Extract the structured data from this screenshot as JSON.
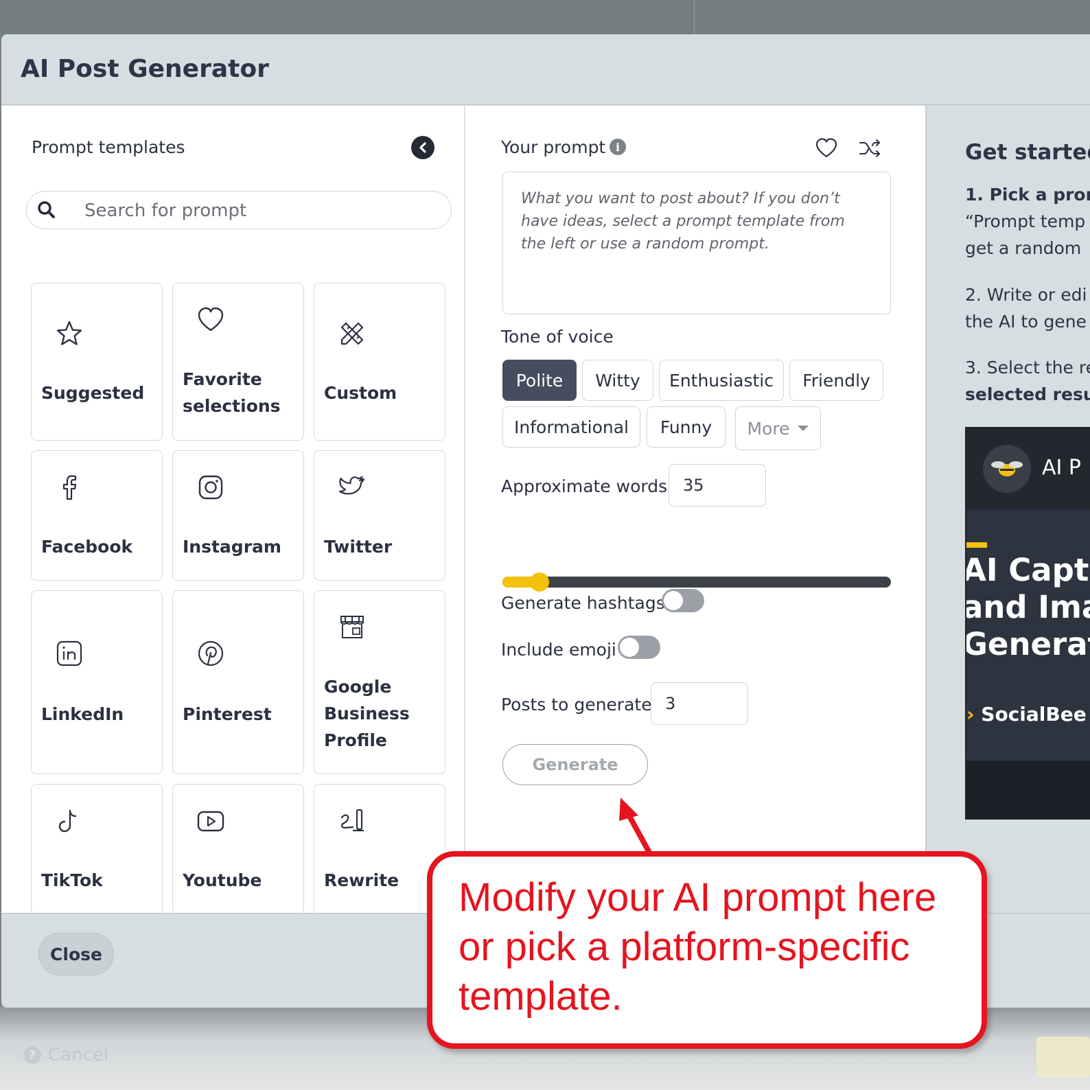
{
  "modal": {
    "title": "AI Post Generator",
    "close_label": "Close"
  },
  "background": {
    "cancel_label": "Cancel"
  },
  "templates": {
    "title": "Prompt templates",
    "search_placeholder": "Search for prompt",
    "tiles": [
      {
        "label": "Suggested",
        "icon": "star-icon"
      },
      {
        "label": "Favorite selections",
        "icon": "heart-icon"
      },
      {
        "label": "Custom",
        "icon": "pencil-ruler-icon"
      },
      {
        "label": "Facebook",
        "icon": "facebook-icon"
      },
      {
        "label": "Instagram",
        "icon": "instagram-icon"
      },
      {
        "label": "Twitter",
        "icon": "twitter-icon"
      },
      {
        "label": "LinkedIn",
        "icon": "linkedin-icon"
      },
      {
        "label": "Pinterest",
        "icon": "pinterest-icon"
      },
      {
        "label": "Google Business Profile",
        "icon": "storefront-icon"
      },
      {
        "label": "TikTok",
        "icon": "tiktok-icon"
      },
      {
        "label": "Youtube",
        "icon": "youtube-icon"
      },
      {
        "label": "Rewrite",
        "icon": "rewrite-icon"
      }
    ]
  },
  "prompt": {
    "label": "Your prompt",
    "placeholder": "What you want to post about? If you don’t have ideas, select a prompt template from the left or use a random prompt.",
    "value": ""
  },
  "tone": {
    "label": "Tone of voice",
    "options": [
      "Polite",
      "Witty",
      "Enthusiastic",
      "Friendly",
      "Informational",
      "Funny"
    ],
    "selected": "Polite",
    "more_label": "More"
  },
  "words": {
    "label": "Approximate words",
    "value": "35",
    "slider_fraction": 0.07
  },
  "hashtags": {
    "label": "Generate hashtags",
    "enabled": false
  },
  "emoji": {
    "label": "Include emoji",
    "enabled": false
  },
  "posts": {
    "label": "Posts to generate",
    "value": "3"
  },
  "generate_label": "Generate",
  "get_started": {
    "title": "Get started",
    "step1_bold": "1. Pick a prom",
    "step1_line2": "“Prompt temp",
    "step1_line3": "get a random",
    "step2_line1": "2. Write or edi",
    "step2_line2": "the AI to gene",
    "step3_line1": "3. Select the re",
    "step3_line2": "selected resu",
    "video": {
      "title": "AI P",
      "headline": [
        "AI Captio",
        "and Ima",
        "Generat"
      ],
      "brand": "SocialBee"
    }
  },
  "callout": {
    "text": "Modify your AI prompt here or pick a platform-specific template."
  },
  "colors": {
    "accent": "#f4c20d",
    "active_tone": "#454d5e",
    "callout": "#e5141f"
  }
}
